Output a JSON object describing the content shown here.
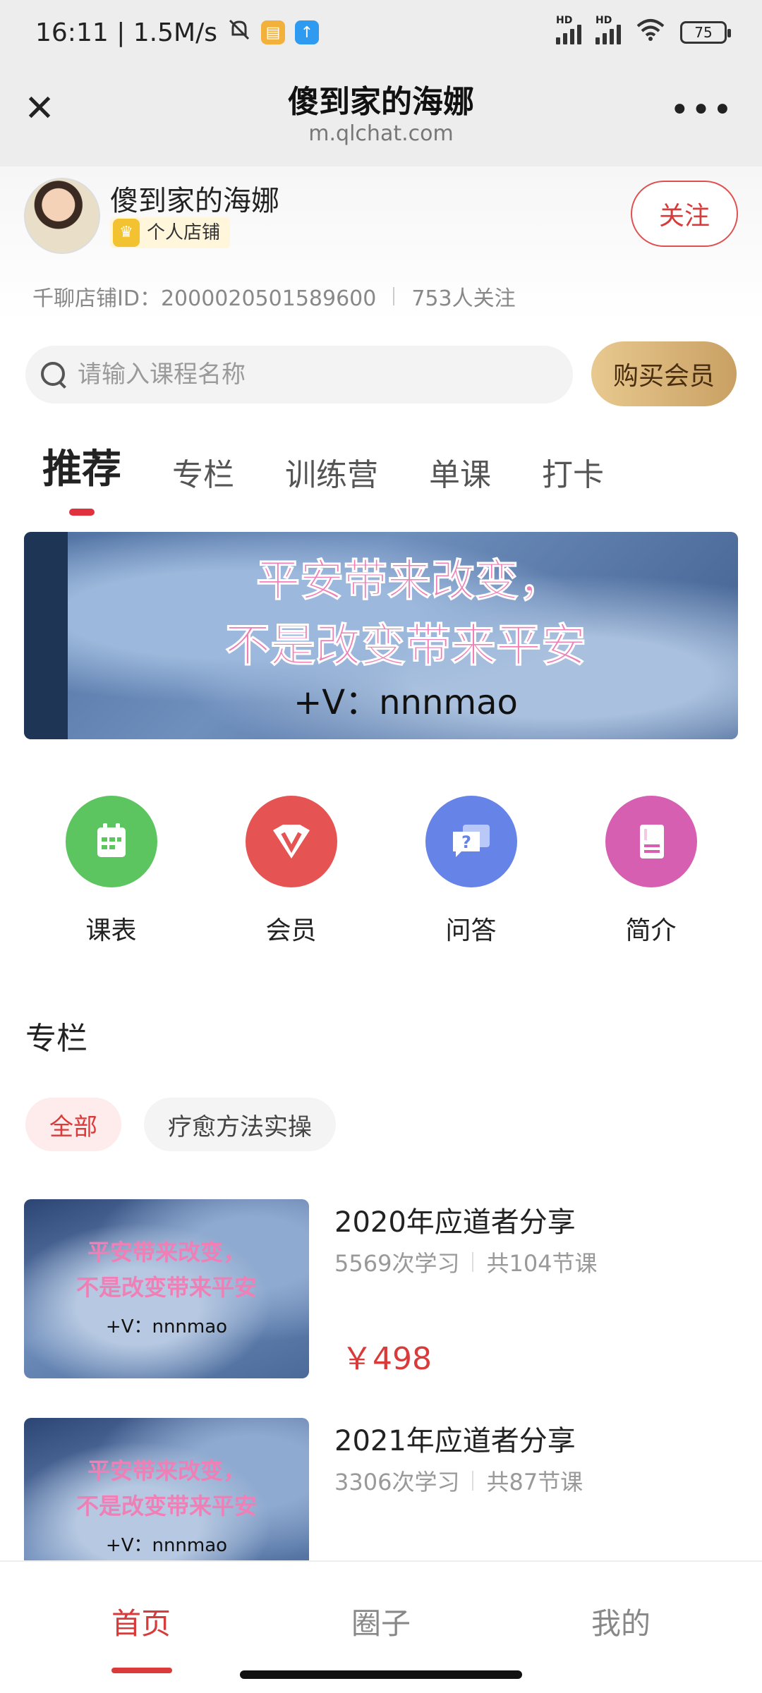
{
  "status_bar": {
    "time_speed": "16:11 | 1.5M/s",
    "battery": "75",
    "hd_label": "HD",
    "bell_icon": "bell-off-icon"
  },
  "browser": {
    "title": "傻到家的海娜",
    "url": "m.qlchat.com",
    "close_icon": "✕",
    "more_icon": "•••"
  },
  "shop": {
    "name": "傻到家的海娜",
    "badge": "个人店铺",
    "follow_label": "关注",
    "shop_id": "千聊店铺ID：2000020501589600",
    "followers": "753人关注"
  },
  "search": {
    "placeholder": "请输入课程名称"
  },
  "member_button": "购买会员",
  "tabs": [
    {
      "label": "推荐"
    },
    {
      "label": "专栏"
    },
    {
      "label": "训练营"
    },
    {
      "label": "单课"
    },
    {
      "label": "打卡"
    }
  ],
  "banner": {
    "line1": "平安带来改变，",
    "line2": "不是改变带来平安",
    "line3": "+V：nnnmao"
  },
  "quick_links": [
    {
      "label": "课表",
      "color": "#5cc560"
    },
    {
      "label": "会员",
      "color": "#e55452"
    },
    {
      "label": "问答",
      "color": "#6683e8"
    },
    {
      "label": "简介",
      "color": "#d65fb1"
    }
  ],
  "section": {
    "title": "专栏",
    "chips": [
      {
        "label": "全部"
      },
      {
        "label": "疗愈方法实操"
      }
    ]
  },
  "courses": [
    {
      "title": "2020年应道者分享",
      "learns": "5569次学习",
      "lessons": "共104节课",
      "price": "￥498",
      "thumb_line1": "平安带来改变，",
      "thumb_line2": "不是改变带来平安",
      "thumb_line3": "+V：nnnmao"
    },
    {
      "title": "2021年应道者分享",
      "learns": "3306次学习",
      "lessons": "共87节课",
      "thumb_line1": "平安带来改变，",
      "thumb_line2": "不是改变带来平安",
      "thumb_line3": "+V：nnnmao"
    }
  ],
  "bottom_nav": [
    {
      "label": "首页"
    },
    {
      "label": "圈子"
    },
    {
      "label": "我的"
    }
  ]
}
